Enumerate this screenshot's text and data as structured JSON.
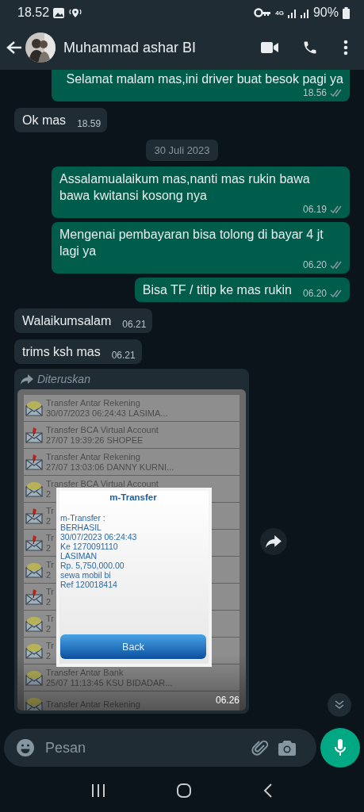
{
  "status_bar": {
    "time": "18.52",
    "network": "4G",
    "battery": "90%"
  },
  "header": {
    "contact_name": "Muhammad ashar BI"
  },
  "messages": [
    {
      "kind": "text",
      "outgoing": true,
      "text": "Selamat malam mas,ini driver buat besok pagi ya",
      "time": "18.56",
      "read": false
    },
    {
      "kind": "text",
      "outgoing": false,
      "text": "Ok mas",
      "time": "18.59"
    },
    {
      "kind": "date",
      "text": "30 Juli 2023"
    },
    {
      "kind": "text",
      "outgoing": true,
      "text": "Assalamualaikum mas,nanti mas rukin bawa bawa kwitansi kosong nya",
      "time": "06.19",
      "read": false
    },
    {
      "kind": "text",
      "outgoing": true,
      "text": "Mengenai pembayaran bisa tolong di bayar 4 jt lagi ya",
      "time": "06.20",
      "read": false
    },
    {
      "kind": "text",
      "outgoing": true,
      "text": "Bisa TF / titip ke mas rukin",
      "time": "06.20",
      "read": false
    },
    {
      "kind": "text",
      "outgoing": false,
      "text": "Walaikumsalam",
      "time": "06.21"
    },
    {
      "kind": "text",
      "outgoing": false,
      "text": "trims ksh mas",
      "time": "06.21"
    },
    {
      "kind": "forwarded_image",
      "outgoing": false,
      "forwarded_label": "Diteruskan",
      "time": "06.26",
      "screenshot": {
        "rows": [
          {
            "title": "Transfer Antar Rekening",
            "subtitle": "30/07/2023 06:24:43 LASIMA...",
            "flagged": false
          },
          {
            "title": "Transfer BCA Virtual Account",
            "subtitle": "27/07 19:39:26 SHOPEE",
            "flagged": true
          },
          {
            "title": "Transfer Antar Rekening",
            "subtitle": "27/07 13:03:06 DANNY KURNI...",
            "flagged": true
          },
          {
            "title": "Transfer BCA Virtual Account",
            "subtitle": "2",
            "flagged": false
          },
          {
            "title": "Tr",
            "subtitle": "2",
            "flagged": true
          },
          {
            "title": "Tr",
            "subtitle": "2",
            "flagged": true
          },
          {
            "title": "Tr",
            "subtitle": "2",
            "flagged": false
          },
          {
            "title": "Tr",
            "subtitle": "2",
            "flagged": true
          },
          {
            "title": "Tr",
            "subtitle": "2",
            "flagged": false
          },
          {
            "title": "Tr",
            "subtitle": "2",
            "flagged": false
          },
          {
            "title": "Transfer Antar Bank",
            "subtitle": "25/07 11:13:45 KSU BIDADAR...",
            "flagged": false
          },
          {
            "title": "Transfer Antar Rekening",
            "flagged": false
          }
        ],
        "dialog": {
          "title": "m-Transfer",
          "lines": [
            "m-Transfer :",
            "BERHASIL",
            "30/07/2023 06:24:43",
            "Ke 1270091110",
            "LASIMAN",
            "Rp. 5,750,000.00",
            "sewa mobil bi",
            "Ref 120018414"
          ],
          "button": "Back"
        }
      }
    }
  ],
  "composer": {
    "placeholder": "Pesan"
  }
}
